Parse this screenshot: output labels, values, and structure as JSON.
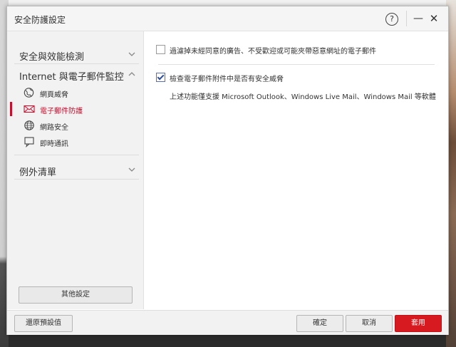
{
  "window": {
    "title": "安全防護設定",
    "help_label": "?",
    "minimize_label": "—",
    "close_label": "✕"
  },
  "sidebar": {
    "sections": [
      {
        "label": "安全與效能檢測",
        "chevron": "chevron-down-icon"
      },
      {
        "label": "Internet 與電子郵件監控",
        "chevron": "chevron-up-icon"
      },
      {
        "label": "例外清單",
        "chevron": "chevron-down-icon"
      }
    ],
    "items": [
      {
        "label": "網頁威脅",
        "icon": "globe-shield-icon",
        "active": false
      },
      {
        "label": "電子郵件防護",
        "icon": "mail-icon",
        "active": true
      },
      {
        "label": "網路安全",
        "icon": "network-globe-icon",
        "active": false
      },
      {
        "label": "即時通訊",
        "icon": "chat-monitor-icon",
        "active": false
      }
    ],
    "other_settings_label": "其他設定"
  },
  "content": {
    "options": [
      {
        "label": "過濾掉未經同意的廣告、不受歡迎或可能夾帶惡意網址的電子郵件",
        "checked": false
      },
      {
        "label": "檢查電子郵件附件中是否有安全威脅",
        "checked": true
      }
    ],
    "note": "上述功能僅支援 Microsoft Outlook、Windows Live Mail、Windows Mail 等軟體"
  },
  "footer": {
    "restore_label": "還原預設值",
    "ok_label": "確定",
    "cancel_label": "取消",
    "apply_label": "套用"
  },
  "colors": {
    "accent": "#d71920",
    "active_text": "#c8102e",
    "sidebar_bg": "#f2f2f2"
  }
}
